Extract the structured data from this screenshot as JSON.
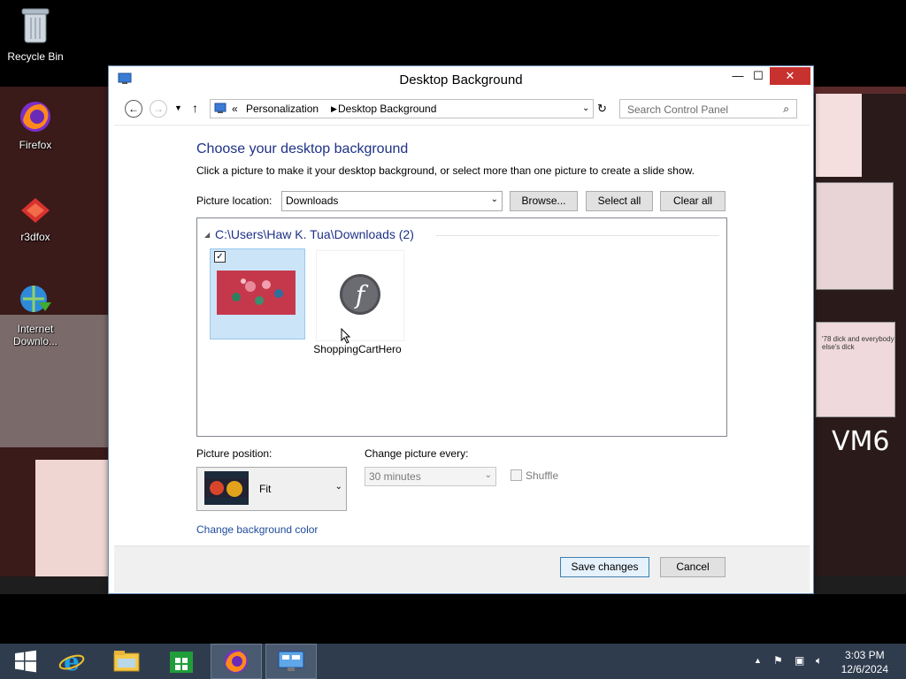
{
  "desktop": {
    "icons": [
      {
        "label": "Recycle Bin"
      },
      {
        "label": "Firefox"
      },
      {
        "label": "r3dfox"
      },
      {
        "label": "Internet Downlo..."
      }
    ],
    "wallpaper_text": {
      "note": "'78 dick and everybody else's dick",
      "vm6": "VM6"
    }
  },
  "window": {
    "title": "Desktop Background",
    "controls": {
      "minimize": "—",
      "maximize": "☐",
      "close": "✕"
    },
    "breadcrumb": [
      "«",
      "Personalization",
      "Desktop Background"
    ],
    "search_placeholder": "Search Control Panel",
    "heading": "Choose your desktop background",
    "subtext": "Click a picture to make it your desktop background, or select more than one picture to create a slide show.",
    "picture_location_label": "Picture location:",
    "picture_location_value": "Downloads",
    "buttons": {
      "browse": "Browse...",
      "select_all": "Select all",
      "clear_all": "Clear all"
    },
    "group_header": "C:\\Users\\Haw K. Tua\\Downloads (2)",
    "pictures": [
      {
        "name": "",
        "selected": true
      },
      {
        "name": "ShoppingCartHero",
        "selected": false
      }
    ],
    "picture_position_label": "Picture position:",
    "picture_position_value": "Fit",
    "change_every_label": "Change picture every:",
    "change_every_value": "30 minutes",
    "shuffle_label": "Shuffle",
    "bg_color_link": "Change background color",
    "save_label": "Save changes",
    "cancel_label": "Cancel"
  },
  "taskbar": {
    "items": [
      "start",
      "internet-explorer",
      "file-explorer",
      "store",
      "firefox",
      "control-panel"
    ],
    "time": "3:03 PM",
    "date": "12/6/2024"
  }
}
